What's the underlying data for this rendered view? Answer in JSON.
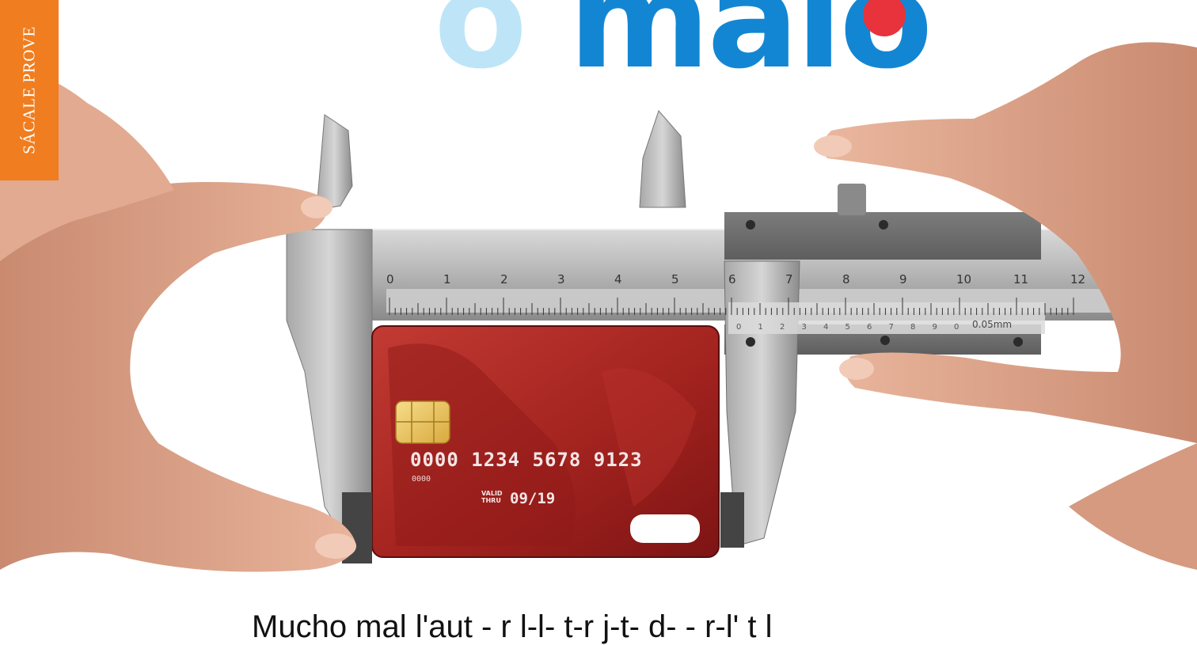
{
  "side_tab": {
    "label": "SÁCALE PROVE"
  },
  "headline": {
    "part_light": "o",
    "part_dark": "malo"
  },
  "caliper": {
    "main_ticks": [
      "0",
      "1",
      "2",
      "3",
      "4",
      "5",
      "6",
      "7",
      "8",
      "9",
      "10",
      "11",
      "12"
    ],
    "vernier_ticks": [
      "0",
      "1",
      "2",
      "3",
      "4",
      "5",
      "6",
      "7",
      "8",
      "9",
      "0"
    ],
    "scale_label": "0.05mm"
  },
  "card": {
    "number": "0000 1234 5678 9123",
    "small_number": "0000",
    "valid_label": "VALID\nTHRU",
    "valid_value": "09/19"
  },
  "tagline": "Mucho mal l'aut - r l-l- t-r j-t- d- - r-l' t l"
}
